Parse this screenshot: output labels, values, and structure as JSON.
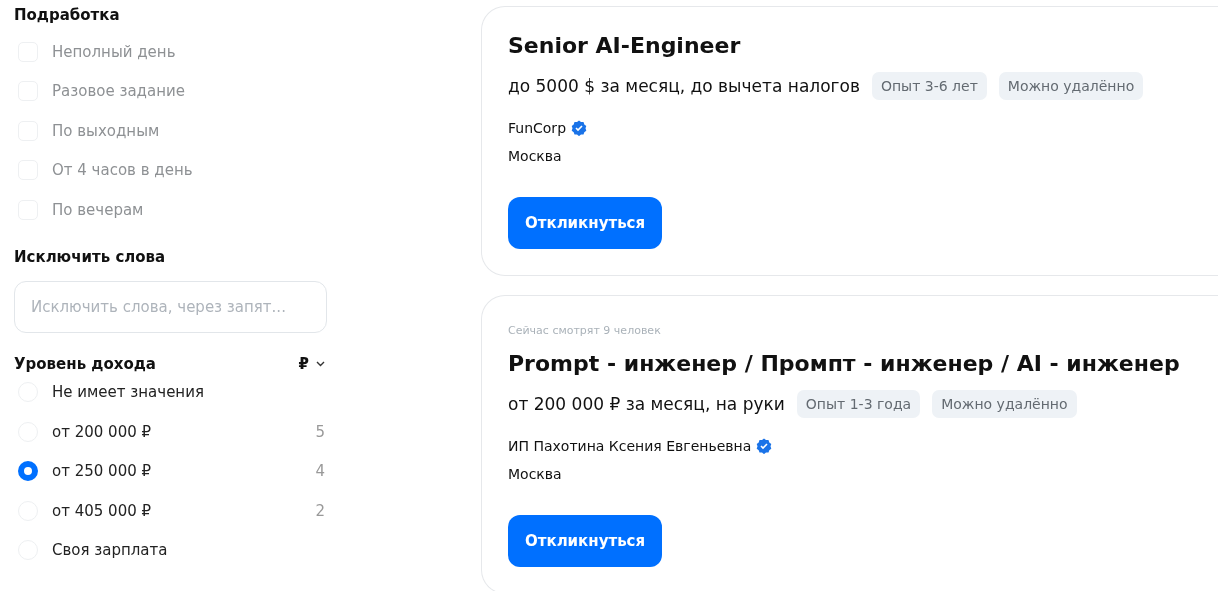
{
  "filters": {
    "part_time": {
      "title": "Подработка",
      "options": [
        {
          "label": "Неполный день",
          "checked": false,
          "disabled": true
        },
        {
          "label": "Разовое задание",
          "checked": false,
          "disabled": true
        },
        {
          "label": "По выходным",
          "checked": false,
          "disabled": true
        },
        {
          "label": "От 4 часов в день",
          "checked": false,
          "disabled": true
        },
        {
          "label": "По вечерам",
          "checked": false,
          "disabled": true
        }
      ]
    },
    "exclude_words": {
      "title": "Исключить слова",
      "placeholder": "Исключить слова, через запят..."
    },
    "income": {
      "title": "Уровень дохода",
      "currency": "₽",
      "options": [
        {
          "label": "Не имеет значения",
          "selected": false
        },
        {
          "label": "от 200 000 ₽",
          "count": "5",
          "selected": false
        },
        {
          "label": "от 250 000 ₽",
          "count": "4",
          "selected": true
        },
        {
          "label": "от 405 000 ₽",
          "count": "2",
          "selected": false
        },
        {
          "label": "Своя зарплата",
          "selected": false
        }
      ]
    }
  },
  "vacancies": [
    {
      "title": "Senior AI-Engineer",
      "salary": "до 5000 $ за месяц, до вычета налогов",
      "tags": [
        "Опыт 3-6 лет",
        "Можно удалённо"
      ],
      "company": "FunCorp",
      "verified": true,
      "city": "Москва",
      "button": "Откликнуться"
    },
    {
      "viewers": "Сейчас смотрят 9 человек",
      "title": "Prompt - инженер / Промпт - инженер / AI - инженер",
      "salary": "от 200 000 ₽ за месяц, на руки",
      "tags": [
        "Опыт 1-3 года",
        "Можно удалённо"
      ],
      "company": "ИП Пахотина Ксения Евгеньевна",
      "verified": true,
      "city": "Москва",
      "button": "Откликнуться"
    }
  ]
}
